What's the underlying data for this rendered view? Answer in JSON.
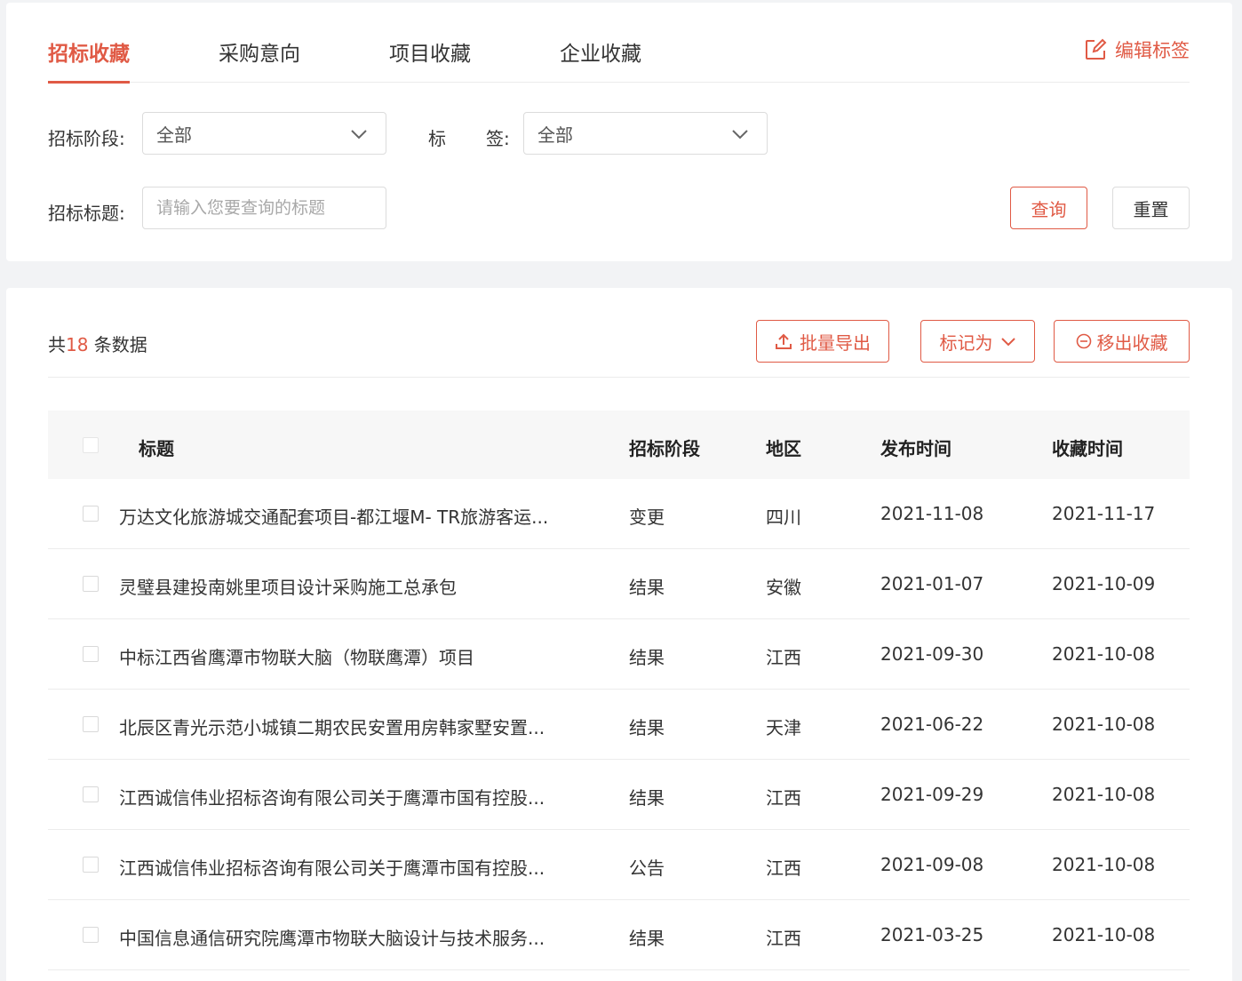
{
  "tabs": [
    {
      "label": "招标收藏",
      "active": true
    },
    {
      "label": "采购意向",
      "active": false
    },
    {
      "label": "项目收藏",
      "active": false
    },
    {
      "label": "企业收藏",
      "active": false
    }
  ],
  "edit_tags_label": "编辑标签",
  "filters": {
    "stage_label": "招标阶段:",
    "stage_value": "全部",
    "tag_label_1": "标",
    "tag_label_2": "签:",
    "tag_value": "全部",
    "title_label": "招标标题:",
    "title_placeholder": "请输入您要查询的标题",
    "query_button": "查询",
    "reset_button": "重置"
  },
  "list": {
    "count_prefix": "共",
    "count": "18",
    "count_suffix": " 条数据",
    "export_button": "批量导出",
    "mark_button": "标记为",
    "remove_button": "移出收藏"
  },
  "table": {
    "headers": {
      "title": "标题",
      "stage": "招标阶段",
      "region": "地区",
      "published": "发布时间",
      "favorited": "收藏时间"
    },
    "rows": [
      {
        "title": "万达文化旅游城交通配套项目-都江堰M- TR旅游客运...",
        "stage": "变更",
        "region": "四川",
        "published": "2021-11-08",
        "favorited": "2021-11-17"
      },
      {
        "title": "灵璧县建投南姚里项目设计采购施工总承包",
        "stage": "结果",
        "region": "安徽",
        "published": "2021-01-07",
        "favorited": "2021-10-09"
      },
      {
        "title": "中标江西省鹰潭市物联大脑（物联鹰潭）项目",
        "stage": "结果",
        "region": "江西",
        "published": "2021-09-30",
        "favorited": "2021-10-08"
      },
      {
        "title": "北辰区青光示范小城镇二期农民安置用房韩家墅安置...",
        "stage": "结果",
        "region": "天津",
        "published": "2021-06-22",
        "favorited": "2021-10-08"
      },
      {
        "title": "江西诚信伟业招标咨询有限公司关于鹰潭市国有控股...",
        "stage": "结果",
        "region": "江西",
        "published": "2021-09-29",
        "favorited": "2021-10-08"
      },
      {
        "title": "江西诚信伟业招标咨询有限公司关于鹰潭市国有控股...",
        "stage": "公告",
        "region": "江西",
        "published": "2021-09-08",
        "favorited": "2021-10-08"
      },
      {
        "title": "中国信息通信研究院鹰潭市物联大脑设计与技术服务...",
        "stage": "结果",
        "region": "江西",
        "published": "2021-03-25",
        "favorited": "2021-10-08"
      }
    ]
  },
  "colors": {
    "accent": "#e05a45",
    "border": "#dcdcdc",
    "background": "#f2f3f5"
  }
}
